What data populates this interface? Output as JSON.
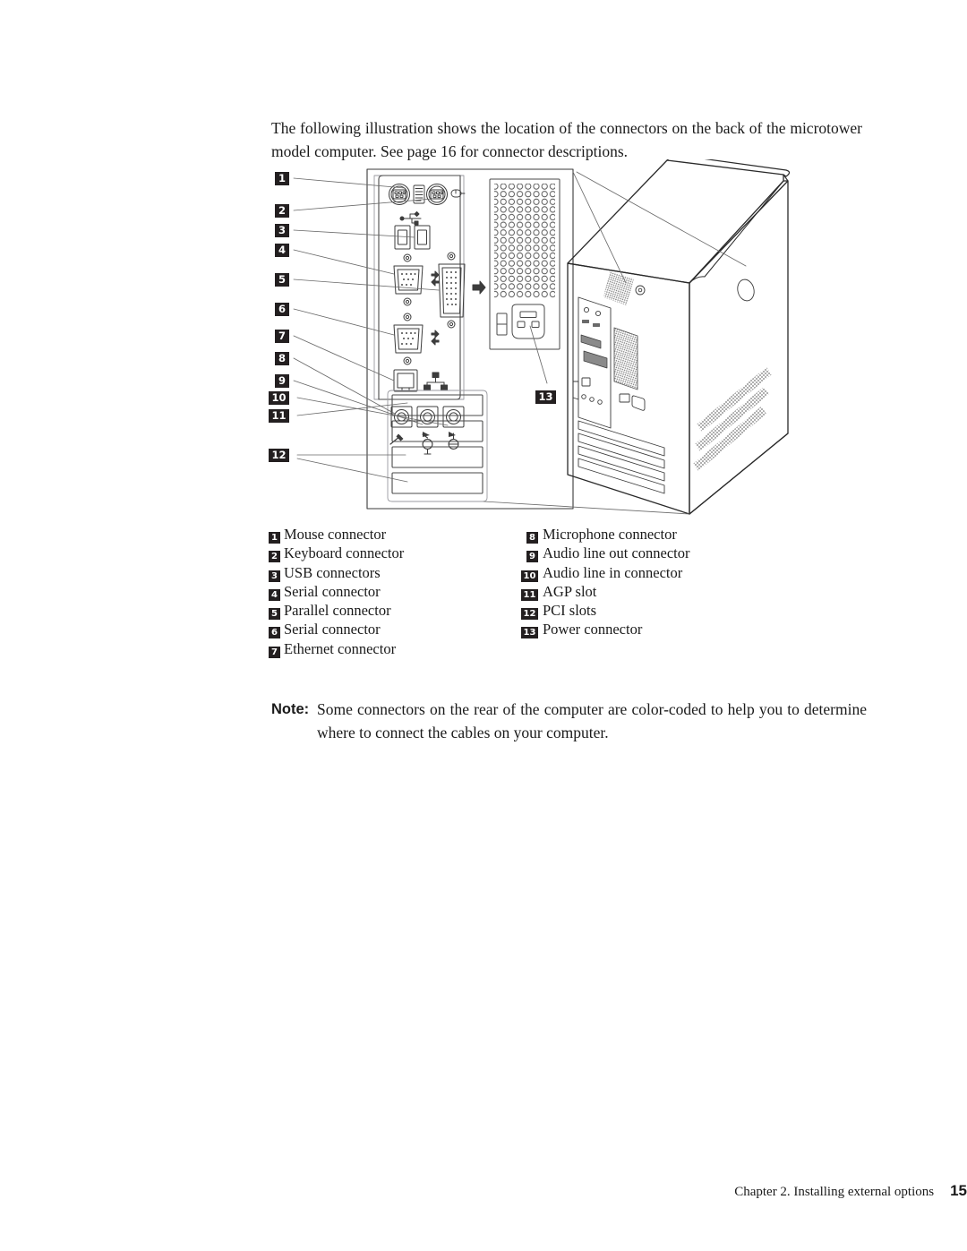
{
  "intro": {
    "text": "The following illustration shows the location of the connectors on the back of the microtower model computer. See page 16 for connector descriptions."
  },
  "figure": {
    "alt": "Line drawing of the rear of the microtower model computer showing connector locations",
    "callouts": [
      {
        "id": "1",
        "label": "1"
      },
      {
        "id": "2",
        "label": "2"
      },
      {
        "id": "3",
        "label": "3"
      },
      {
        "id": "4",
        "label": "4"
      },
      {
        "id": "5",
        "label": "5"
      },
      {
        "id": "6",
        "label": "6"
      },
      {
        "id": "7",
        "label": "7"
      },
      {
        "id": "8",
        "label": "8"
      },
      {
        "id": "9",
        "label": "9"
      },
      {
        "id": "10",
        "label": "10"
      },
      {
        "id": "11",
        "label": "11"
      },
      {
        "id": "12",
        "label": "12"
      },
      {
        "id": "13",
        "label": "13"
      }
    ]
  },
  "legend": {
    "left": [
      {
        "num": "1",
        "label": "Mouse connector"
      },
      {
        "num": "2",
        "label": "Keyboard connector"
      },
      {
        "num": "3",
        "label": "USB connectors"
      },
      {
        "num": "4",
        "label": "Serial connector"
      },
      {
        "num": "5",
        "label": "Parallel connector"
      },
      {
        "num": "6",
        "label": "Serial connector"
      },
      {
        "num": "7",
        "label": "Ethernet connector"
      }
    ],
    "right": [
      {
        "num": "8",
        "label": "Microphone connector"
      },
      {
        "num": "9",
        "label": "Audio line out connector"
      },
      {
        "num": "10",
        "label": "Audio line in connector"
      },
      {
        "num": "11",
        "label": "AGP slot"
      },
      {
        "num": "12",
        "label": "PCI slots"
      },
      {
        "num": "13",
        "label": "Power connector"
      }
    ]
  },
  "note": {
    "label": "Note:",
    "text": "Some connectors on the rear of the computer are color-coded to help you to determine where to connect the cables on your computer."
  },
  "footer": {
    "chapter": "Chapter 2. Installing external options",
    "page": "15"
  }
}
